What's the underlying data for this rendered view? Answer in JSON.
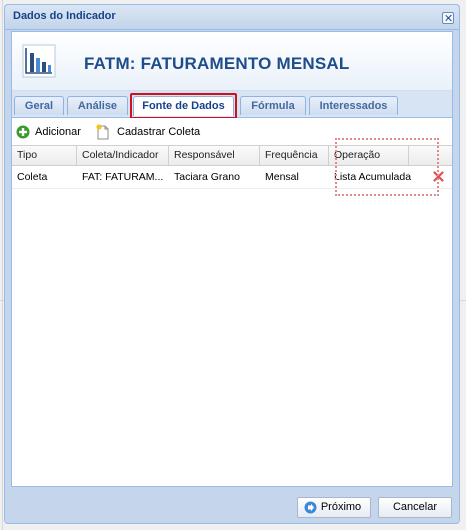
{
  "window": {
    "title": "Dados do Indicador"
  },
  "header": {
    "title": "FATM: FATURAMENTO MENSAL"
  },
  "tabs": [
    {
      "label": "Geral"
    },
    {
      "label": "Análise"
    },
    {
      "label": "Fonte de Dados"
    },
    {
      "label": "Fórmula"
    },
    {
      "label": "Interessados"
    }
  ],
  "toolbar": {
    "add_label": "Adicionar",
    "register_label": "Cadastrar Coleta"
  },
  "grid": {
    "columns": [
      "Tipo",
      "Coleta/Indicador",
      "Responsável",
      "Frequência",
      "Operação"
    ],
    "rows": [
      {
        "tipo": "Coleta",
        "coleta": "FAT: FATURAM...",
        "responsavel": "Taciara Grano",
        "frequencia": "Mensal",
        "operacao": "Lista Acumulada"
      }
    ]
  },
  "footer": {
    "next_label": "Próximo",
    "cancel_label": "Cancelar"
  },
  "colors": {
    "accent": "#15428b",
    "highlight_red": "#d0101a"
  }
}
